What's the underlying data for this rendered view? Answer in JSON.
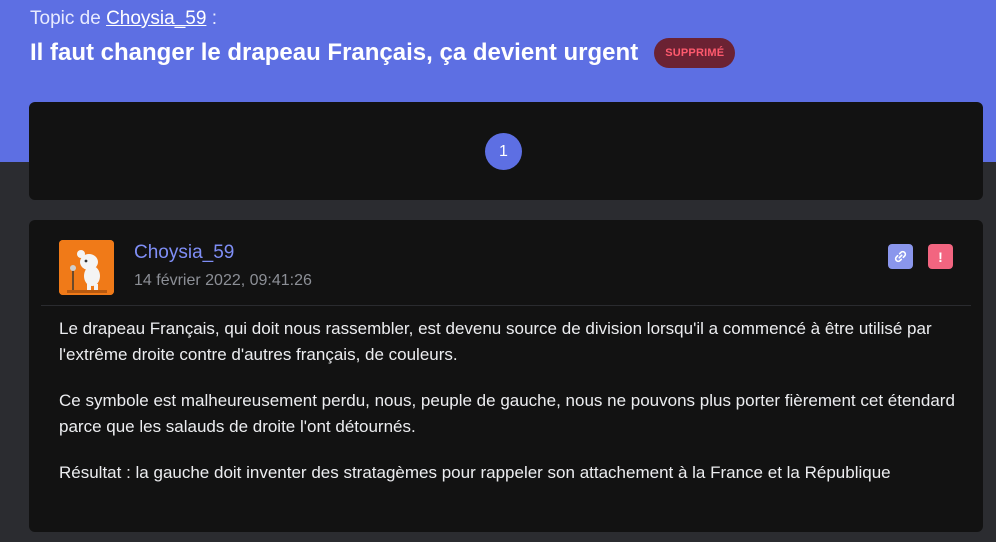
{
  "header": {
    "topic_prefix": "Topic de",
    "topic_author": "Choysia_59",
    "topic_suffix": ":",
    "title": "Il faut changer le drapeau Français, ça devient urgent",
    "status_badge": "SUPPRIMÉ"
  },
  "pagination": {
    "current_page": "1"
  },
  "post": {
    "author": "Choysia_59",
    "date": "14 février 2022, 09:41:26",
    "avatar_icon": "poodle-avatar-icon",
    "actions": {
      "link_icon": "link-icon",
      "report_icon": "report-icon",
      "report_label": "!"
    },
    "paragraphs": [
      "Le drapeau Français, qui doit nous rassembler, est devenu source de division lorsqu'il a commencé à être utilisé par l'extrême droite contre d'autres français, de couleurs.",
      "Ce symbole est malheureusement perdu, nous, peuple de gauche, nous ne pouvons plus porter fièrement cet étendard parce que les salauds de droite l'ont détournés.",
      "Résultat : la gauche doit inventer des stratagèmes pour rappeler son attachement à la France et la République"
    ]
  },
  "colors": {
    "accent": "#5d6fe3",
    "badge_bg": "#6b2233",
    "badge_text": "#ff5a6e",
    "card_bg": "#121212",
    "page_bg": "#2b2c30",
    "author_link": "#7f8ef5"
  }
}
